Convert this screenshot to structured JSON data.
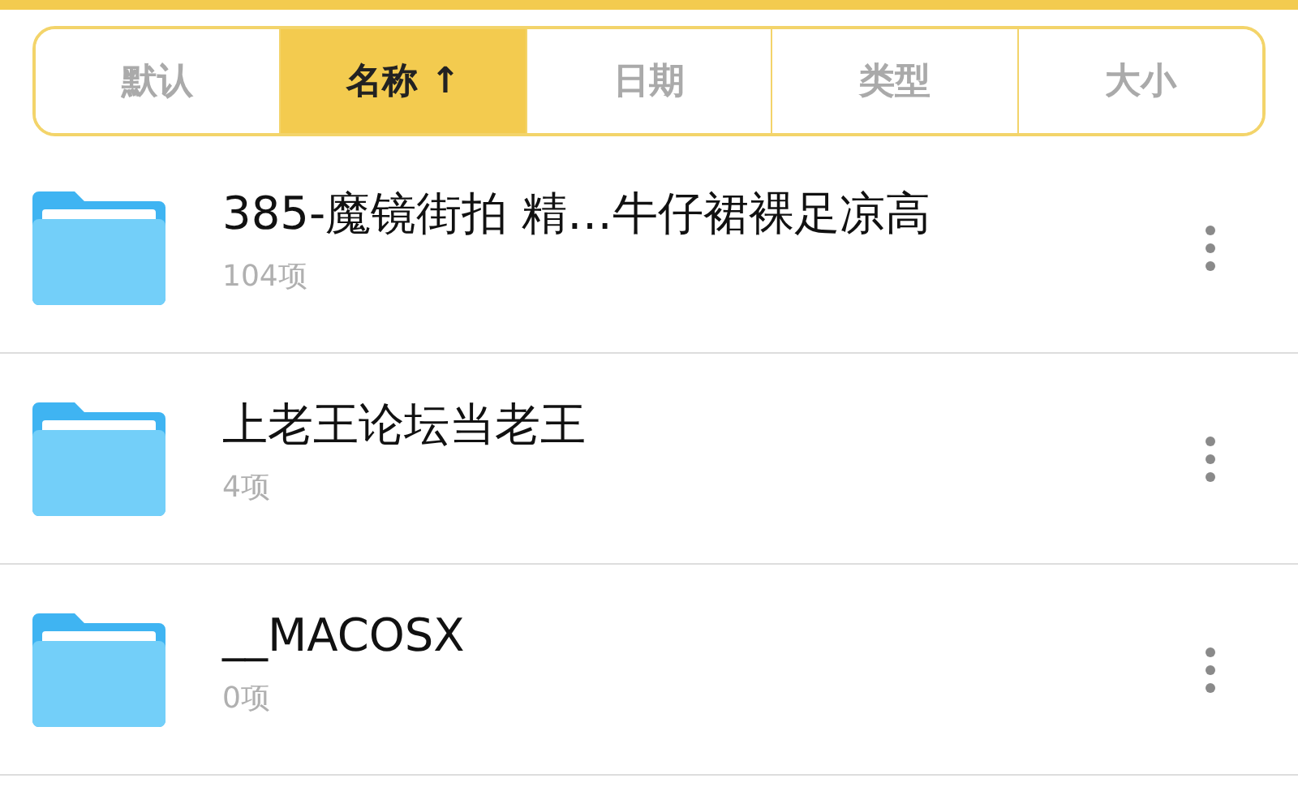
{
  "sort_tabs": [
    {
      "label": "默认",
      "selected": false
    },
    {
      "label": "名称",
      "arrow": "↑",
      "selected": true
    },
    {
      "label": "日期",
      "selected": false
    },
    {
      "label": "类型",
      "selected": false
    },
    {
      "label": "大小",
      "selected": false
    }
  ],
  "files": [
    {
      "name": "385-魔镜街拍 精…牛仔裙裸足凉高",
      "count": "104项"
    },
    {
      "name": "上老王论坛当老王",
      "count": "4项"
    },
    {
      "name": "__MACOSX",
      "count": "0项"
    }
  ]
}
